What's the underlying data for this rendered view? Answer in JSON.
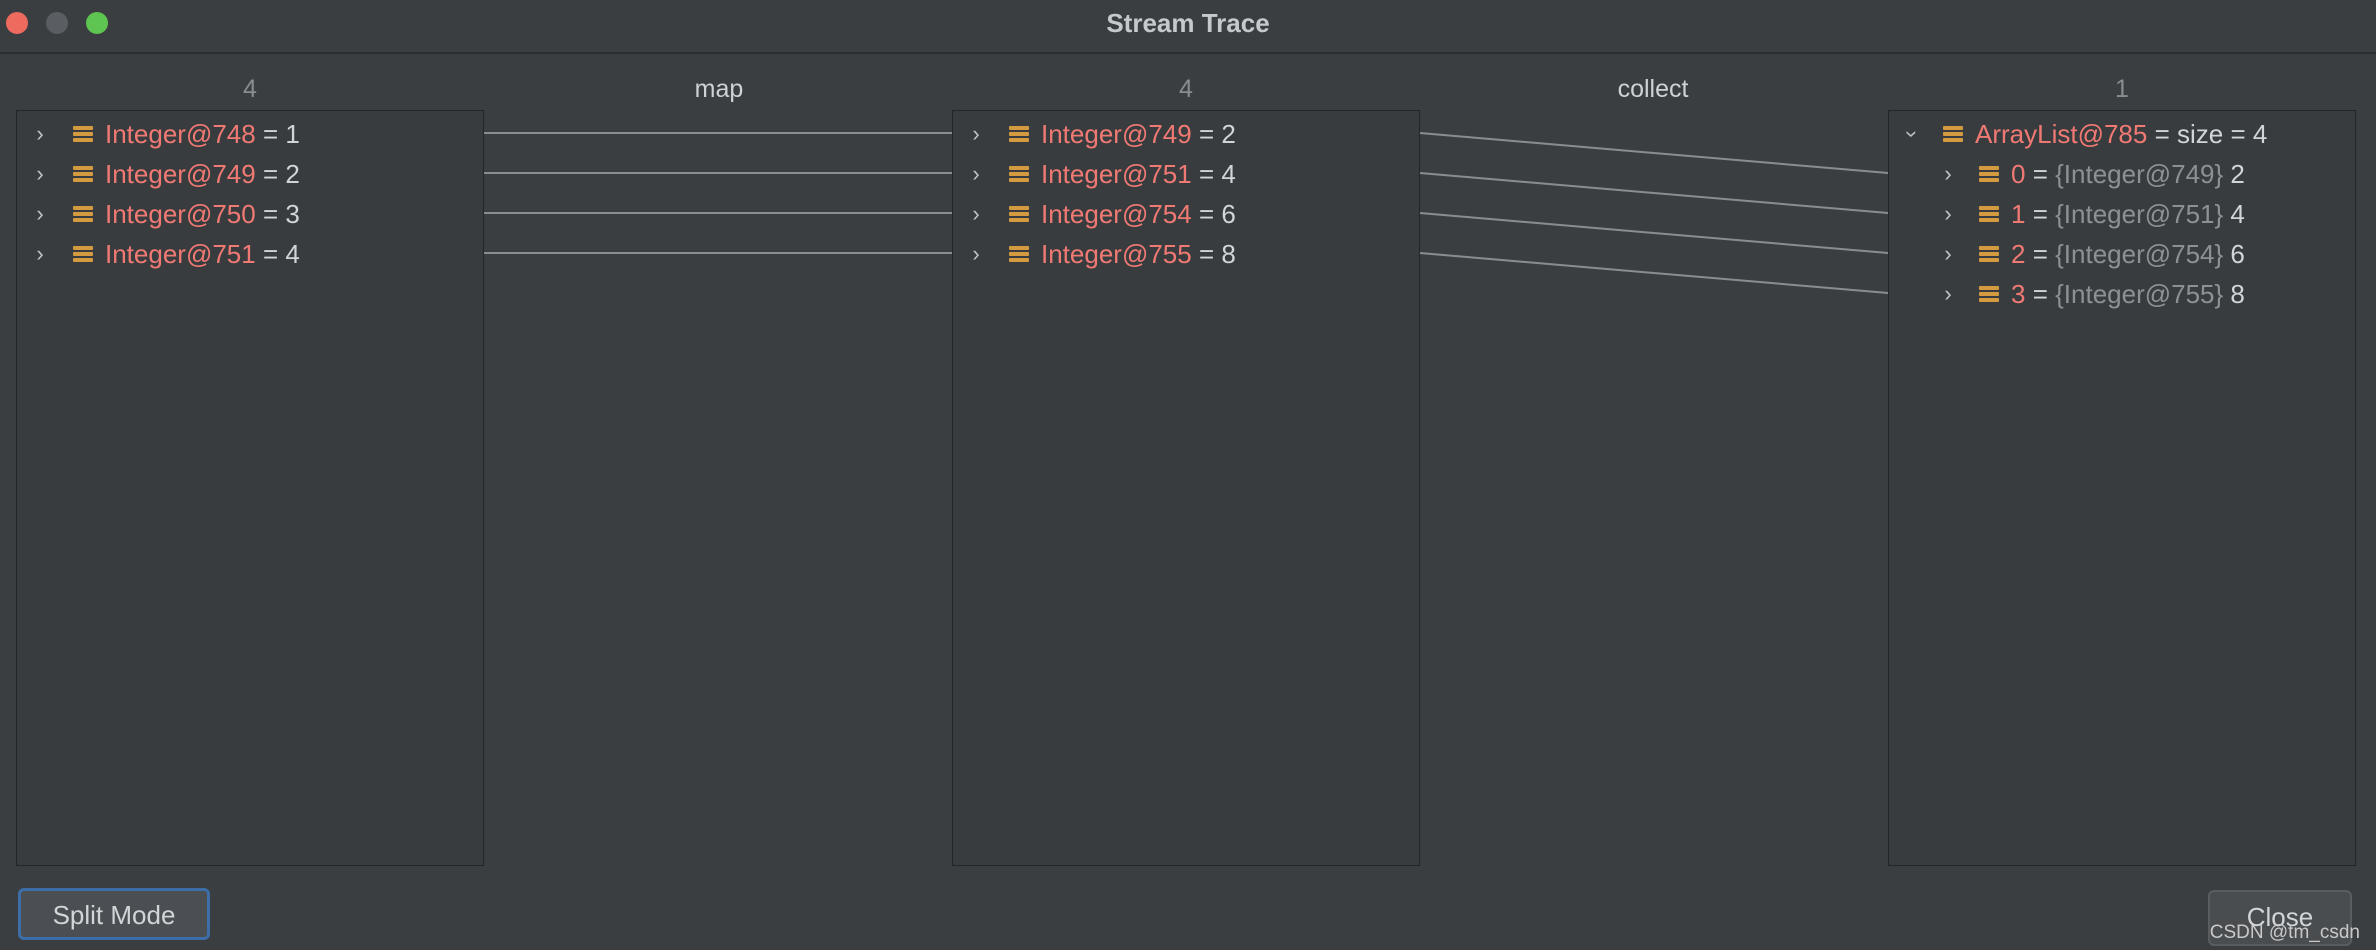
{
  "window": {
    "title": "Stream Trace"
  },
  "columns": {
    "left_count": "4",
    "op1": "map",
    "middle_count": "4",
    "op2": "collect",
    "right_count": "1"
  },
  "left_items": [
    {
      "name": "Integer@748",
      "eq": "= ",
      "value": "1"
    },
    {
      "name": "Integer@749",
      "eq": "= ",
      "value": "2"
    },
    {
      "name": "Integer@750",
      "eq": "= ",
      "value": "3"
    },
    {
      "name": "Integer@751",
      "eq": "= ",
      "value": "4"
    }
  ],
  "middle_items": [
    {
      "name": "Integer@749",
      "eq": "= ",
      "value": "2"
    },
    {
      "name": "Integer@751",
      "eq": "= ",
      "value": "4"
    },
    {
      "name": "Integer@754",
      "eq": "= ",
      "value": "6"
    },
    {
      "name": "Integer@755",
      "eq": "= ",
      "value": "8"
    }
  ],
  "right_root": {
    "name": "ArrayList@785",
    "eq": " = ",
    "meta": " size = 4"
  },
  "right_children": [
    {
      "index": "0",
      "eq": " = ",
      "meta": "{Integer@749}",
      "value": " 2"
    },
    {
      "index": "1",
      "eq": " = ",
      "meta": "{Integer@751}",
      "value": " 4"
    },
    {
      "index": "2",
      "eq": " = ",
      "meta": "{Integer@754}",
      "value": " 6"
    },
    {
      "index": "3",
      "eq": " = ",
      "meta": "{Integer@755}",
      "value": " 8"
    }
  ],
  "buttons": {
    "split_mode": "Split Mode",
    "close": "Close"
  },
  "watermark": "CSDN @tm_csdn",
  "colors": {
    "link_line": "#8a8d90",
    "object_name": "#f07a73",
    "stack_icon": "#d49a3f"
  },
  "icons": {
    "expand": "chevron-right-icon",
    "collapse": "chevron-down-icon",
    "object": "stack-icon"
  }
}
